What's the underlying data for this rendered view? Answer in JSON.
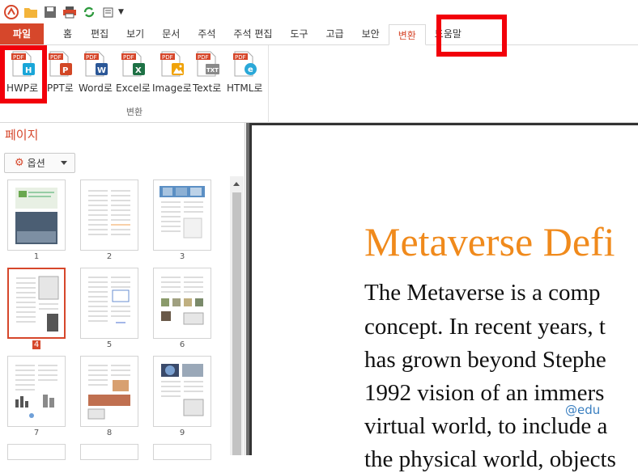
{
  "quick_access": {
    "icons": [
      "app-logo-icon",
      "open-folder-icon",
      "save-icon",
      "print-icon",
      "refresh-icon",
      "page-setup-icon"
    ]
  },
  "tabs": [
    {
      "label": "파일"
    },
    {
      "label": "홈"
    },
    {
      "label": "편집"
    },
    {
      "label": "보기"
    },
    {
      "label": "문서"
    },
    {
      "label": "주석"
    },
    {
      "label": "주석 편집"
    },
    {
      "label": "도구"
    },
    {
      "label": "고급"
    },
    {
      "label": "보안"
    },
    {
      "label": "변환"
    },
    {
      "label": "도움말"
    }
  ],
  "ribbon": {
    "group_label": "변환",
    "buttons": [
      {
        "label": "HWP로",
        "badge": "H",
        "badge_color": "#1aa6d8"
      },
      {
        "label": "PPT로",
        "badge": "P",
        "badge_color": "#d24726"
      },
      {
        "label": "Word로",
        "badge": "W",
        "badge_color": "#2b5797"
      },
      {
        "label": "Excel로",
        "badge": "X",
        "badge_color": "#1e7145"
      },
      {
        "label": "Image로",
        "badge": "▲",
        "badge_color": "#f0a30a"
      },
      {
        "label": "Text로",
        "badge": "TXT",
        "badge_color": "#8a8a8a"
      },
      {
        "label": "HTML로",
        "badge": "e",
        "badge_color": "#2aa8d8"
      }
    ],
    "pdf_label": "PDF"
  },
  "left_panel": {
    "title": "페이지",
    "options_label": "옵션",
    "thumbnails": [
      "1",
      "2",
      "3",
      "4",
      "5",
      "6",
      "7",
      "8",
      "9"
    ],
    "selected_page": "4"
  },
  "document": {
    "title": "Metaverse Defi",
    "lines": [
      "The Metaverse is a comp",
      "concept. In recent years, t",
      "has grown beyond Stephe",
      "1992 vision of an immers",
      "virtual world, to include a",
      "the physical world, objects"
    ],
    "watermark": "@edu"
  },
  "colors": {
    "accent": "#d6472b",
    "highlight": "#f2000a",
    "doc_title": "#f08a1c"
  }
}
